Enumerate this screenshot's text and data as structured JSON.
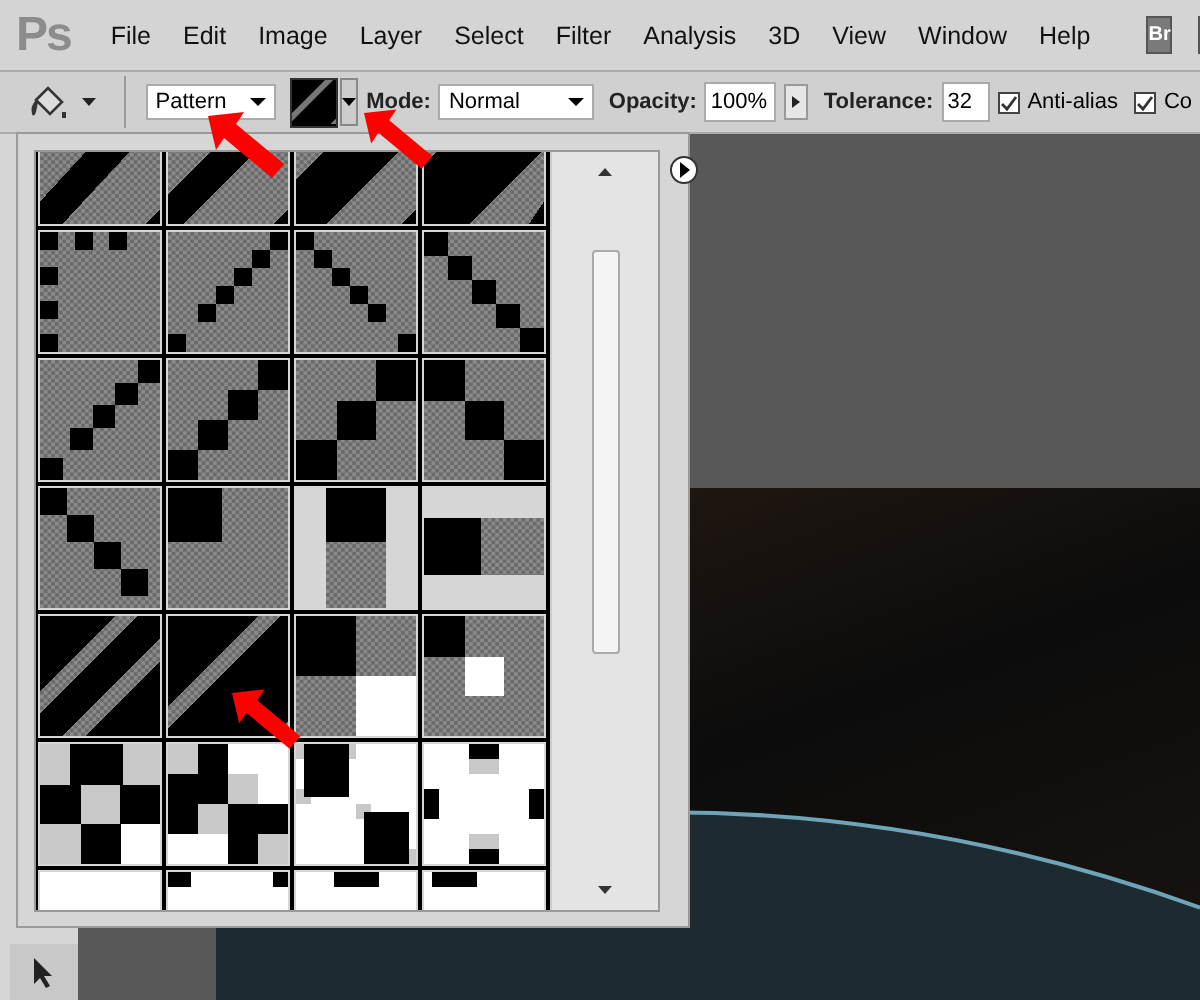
{
  "app_logo": "Ps",
  "menu": [
    "File",
    "Edit",
    "Image",
    "Layer",
    "Select",
    "Filter",
    "Analysis",
    "3D",
    "View",
    "Window",
    "Help"
  ],
  "bridge_button": "Br",
  "options_bar": {
    "fill_source": "Pattern",
    "mode_label": "Mode:",
    "mode": "Normal",
    "opacity_label": "Opacity:",
    "opacity": "100%",
    "tolerance_label": "Tolerance:",
    "tolerance": "32",
    "checkboxes": [
      {
        "label": "Anti-alias",
        "checked": true
      },
      {
        "label": "Co",
        "checked": true
      }
    ]
  }
}
